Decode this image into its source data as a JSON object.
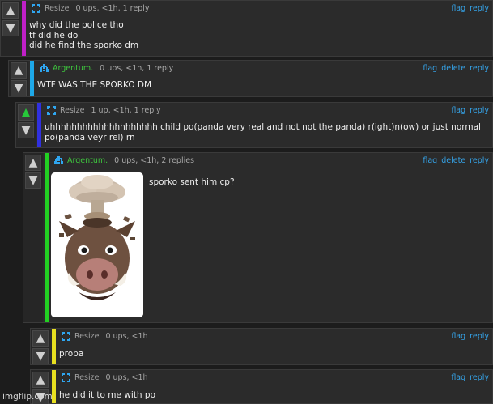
{
  "colors": {
    "accent_link": "#35a3e8",
    "bar_magenta": "#c020c8",
    "bar_cyan": "#1ea8e8",
    "bar_blue": "#3030e0",
    "bar_green": "#22d022",
    "bar_yellow": "#e8e020",
    "upvote_green": "#27c93a"
  },
  "comments": [
    {
      "user": "Resize",
      "stats": "0 ups, <1h, 1 reply",
      "actions": [
        "flag",
        "reply"
      ],
      "lines": [
        "why did the police tho",
        "tf did he do",
        "did he find the sporko dm"
      ]
    },
    {
      "user": "Argentum.",
      "stats": "0 ups, <1h, 1 reply",
      "actions": [
        "flag",
        "delete",
        "reply"
      ],
      "lines": [
        "WTF WAS THE SPORKO DM"
      ]
    },
    {
      "user": "Resize",
      "stats": "1 up, <1h, 1 reply",
      "actions": [
        "flag",
        "reply"
      ],
      "lines": [
        "uhhhhhhhhhhhhhhhhhhhh child po(panda very real and not not the panda) r(ight)n(ow) or just normal",
        "po(panda veyr rel) rn"
      ]
    },
    {
      "user": "Argentum.",
      "stats": "0 ups, <1h, 2 replies",
      "actions": [
        "flag",
        "delete",
        "reply"
      ],
      "lines": [
        "sporko sent him cp?"
      ],
      "image": "animoji boar with exploding head"
    },
    {
      "user": "Resize",
      "stats": "0 ups, <1h",
      "actions": [
        "flag",
        "reply"
      ],
      "lines": [
        "proba"
      ]
    },
    {
      "user": "Resize",
      "stats": "0 ups, <1h",
      "actions": [
        "flag",
        "reply"
      ],
      "lines": [
        "he did it to me with po"
      ]
    }
  ],
  "icons": {
    "upvote": "up-arrow-icon",
    "downvote": "down-arrow-icon",
    "avatar_resize": "bracket-avatar-icon",
    "avatar_argentum": "pixel-invader-avatar-icon"
  },
  "watermark": "imgflip.com"
}
